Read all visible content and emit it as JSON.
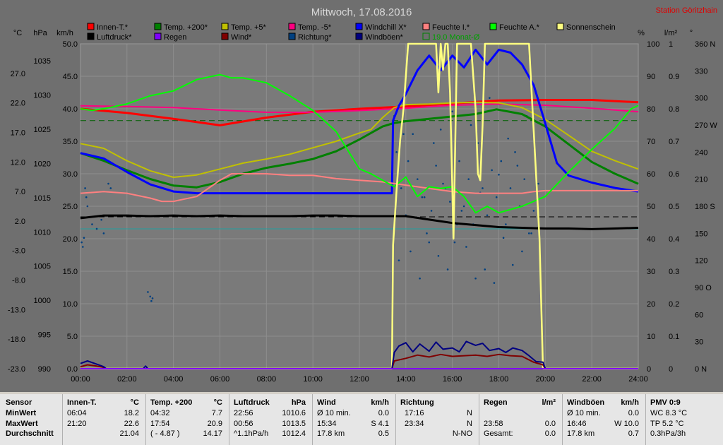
{
  "title": "Mittwoch, 17.08.2016",
  "station": "Station Göritzhain",
  "colors": {
    "plot_bg": "#7a7a7a",
    "grid": "#8e8e8e",
    "frame_bg": "#6f6f6f",
    "title": "#d8d8d8",
    "station": "#e00000"
  },
  "chart_data": {
    "type": "line",
    "x_ticks": [
      "00:00",
      "02:00",
      "04:00",
      "06:00",
      "08:00",
      "10:00",
      "12:00",
      "14:00",
      "16:00",
      "18:00",
      "20:00",
      "22:00",
      "24:00"
    ],
    "x_range_hours": [
      0,
      24
    ],
    "axes": {
      "celsius": {
        "unit": "°C",
        "range": [
          -23,
          32
        ],
        "ticks": [
          "27.0",
          "22.0",
          "17.0",
          "12.0",
          "7.0",
          "2.0",
          "-3.0",
          "-8.0",
          "-13.0",
          "-18.0",
          "-23.0"
        ]
      },
      "hpa": {
        "unit": "hPa",
        "range": [
          990,
          1037.5
        ],
        "ticks": [
          "1035",
          "1030",
          "1025",
          "1020",
          "1015",
          "1010",
          "1005",
          "1000",
          "995",
          "990"
        ]
      },
      "kmh": {
        "unit": "km/h",
        "range": [
          0,
          50
        ],
        "ticks": [
          "50.0",
          "45.0",
          "40.0",
          "35.0",
          "30.0",
          "25.0",
          "20.0",
          "15.0",
          "10.0",
          "5.0",
          "0.0"
        ]
      },
      "percent": {
        "unit": "%",
        "range": [
          0,
          100
        ],
        "ticks": [
          "100",
          "90",
          "80",
          "70",
          "60",
          "50",
          "40",
          "30",
          "20",
          "10",
          "0"
        ]
      },
      "lm2": {
        "unit": "l/m²",
        "range": [
          0,
          1
        ],
        "ticks": [
          "1",
          "0.9",
          "0.8",
          "0.7",
          "0.6",
          "0.5",
          "0.4",
          "0.3",
          "0.2",
          "0.1",
          "0"
        ]
      },
      "deg": {
        "unit": "°",
        "range": [
          0,
          360
        ],
        "ticks": [
          "360 N",
          "330",
          "300",
          "270 W",
          "240",
          "210",
          "180 S",
          "150",
          "120",
          "90 O",
          "60",
          "30",
          "0 N"
        ]
      }
    },
    "legend": [
      {
        "name": "Innen-T.*",
        "color": "#ff0000"
      },
      {
        "name": "Luftdruck*",
        "color": "#000000"
      },
      {
        "name": "Temp. +200*",
        "color": "#008000"
      },
      {
        "name": "Regen",
        "color": "#8000ff"
      },
      {
        "name": "Temp. +5*",
        "color": "#c0c000"
      },
      {
        "name": "Wind*",
        "color": "#800000"
      },
      {
        "name": "Temp. -5*",
        "color": "#ff0080"
      },
      {
        "name": "Richtung*",
        "color": "#004080"
      },
      {
        "name": "Windchill X*",
        "color": "#0000ff"
      },
      {
        "name": "Windböen*",
        "color": "#000080"
      },
      {
        "name": "Feuchte I.*",
        "color": "#ff8080"
      },
      {
        "name": "19.0 Monat-Ø",
        "color": "#008000",
        "text_color": "#00a000",
        "outlined": true
      },
      {
        "name": "Feuchte A.*",
        "color": "#00ff00"
      },
      {
        "name": "Sonnenschein",
        "color": "#ffff80"
      }
    ],
    "series": [
      {
        "name": "Innen-T.*",
        "axis": "celsius",
        "color": "#ff0000",
        "width": 3,
        "x": [
          0,
          2,
          4,
          6,
          8,
          10,
          12,
          14,
          16,
          18,
          20,
          22,
          24
        ],
        "y": [
          21.0,
          20.3,
          19.3,
          18.2,
          19.5,
          20.5,
          21.0,
          21.4,
          21.9,
          22.4,
          22.5,
          22.5,
          22.1
        ]
      },
      {
        "name": "Temp. -5*",
        "axis": "celsius",
        "color": "#ff0080",
        "width": 2,
        "x": [
          0,
          2,
          4,
          6,
          8,
          10,
          12,
          14,
          16,
          18,
          20,
          22,
          24
        ],
        "y": [
          21.5,
          21.4,
          21.2,
          20.8,
          20.4,
          20.4,
          20.7,
          21.1,
          21.6,
          21.8,
          21.6,
          21.1,
          20.5
        ]
      },
      {
        "name": "Temp. +200*",
        "axis": "celsius",
        "color": "#008000",
        "width": 3,
        "x": [
          0,
          1,
          2,
          3,
          4,
          5,
          6,
          7,
          8,
          9,
          10,
          11,
          12,
          13,
          13.5,
          14,
          15,
          16,
          17,
          17.9,
          19,
          20,
          21,
          22,
          23,
          24
        ],
        "y": [
          13.5,
          12.2,
          10.6,
          9.1,
          8.0,
          7.7,
          8.6,
          10.0,
          11.0,
          11.7,
          12.5,
          13.8,
          15.8,
          18.0,
          18.6,
          18.9,
          19.3,
          19.7,
          20.1,
          20.9,
          20.1,
          18.0,
          15.0,
          12.0,
          10.0,
          8.3
        ]
      },
      {
        "name": "Temp. +5*",
        "axis": "celsius",
        "color": "#c0c000",
        "width": 2,
        "x": [
          0,
          1,
          2,
          3,
          4,
          5,
          6,
          7,
          8,
          9,
          10,
          11,
          12,
          12.5,
          13,
          13.5,
          14,
          15,
          16,
          17,
          18,
          19,
          20,
          21,
          22,
          23,
          24
        ],
        "y": [
          15.1,
          14.3,
          12.2,
          10.5,
          9.4,
          9.8,
          10.8,
          11.8,
          12.5,
          13.3,
          14.4,
          15.5,
          16.9,
          17.5,
          19.5,
          21.2,
          21.7,
          21.8,
          22.0,
          22.1,
          22.0,
          21.2,
          19.2,
          16.5,
          13.8,
          12.2,
          10.8
        ]
      },
      {
        "name": "Windchill X*",
        "axis": "celsius",
        "color": "#0000ff",
        "width": 3,
        "x": [
          0,
          1,
          2,
          3,
          4,
          5,
          6,
          7,
          8,
          9,
          10,
          11,
          12,
          13.4,
          13.45,
          13.7,
          14,
          14.5,
          15,
          15.5,
          16,
          16.5,
          17,
          17.5,
          18,
          18.5,
          19,
          19.5,
          20,
          20.5,
          21,
          22,
          23,
          24
        ],
        "y": [
          13.5,
          12.6,
          10.3,
          8.2,
          7.0,
          6.7,
          6.7,
          6.7,
          6.7,
          6.7,
          6.7,
          6.7,
          6.7,
          6.7,
          19.0,
          21.5,
          23.5,
          27.5,
          30.0,
          27.5,
          30.0,
          28.0,
          31.0,
          28.5,
          31.0,
          30.5,
          28.5,
          25.0,
          18.5,
          11.8,
          9.7,
          8.5,
          7.6,
          7.0
        ]
      },
      {
        "name": "Feuchte I.*",
        "axis": "percent",
        "color": "#ff8080",
        "width": 2,
        "x": [
          0,
          1,
          2,
          3,
          3.5,
          4,
          5,
          6,
          6.5,
          7,
          8,
          9,
          10,
          11,
          12,
          13,
          14,
          15,
          16,
          17,
          18,
          19,
          19.5,
          20,
          21,
          22,
          23,
          24
        ],
        "y": [
          54,
          54.5,
          54,
          52.5,
          51.5,
          51.5,
          53,
          58,
          60,
          60,
          60,
          59.5,
          59.5,
          58.5,
          58,
          57.5,
          56.5,
          55.5,
          54.5,
          54,
          54,
          54,
          54.5,
          54.8,
          54.8,
          54.8,
          54.8,
          54.8
        ]
      },
      {
        "name": "Feuchte A.*",
        "axis": "percent",
        "color": "#00ff00",
        "width": 2,
        "x": [
          0,
          0.5,
          1,
          2,
          3,
          4,
          5,
          6,
          6.5,
          7,
          8,
          9,
          10,
          11,
          12,
          12.5,
          13,
          13.5,
          14,
          14.5,
          15,
          15.5,
          16,
          16.5,
          17,
          17.5,
          18,
          19,
          20,
          21,
          22,
          23,
          23.7,
          24
        ],
        "y": [
          80,
          79.5,
          80,
          81.5,
          84,
          85.5,
          89,
          90.5,
          89.5,
          89.5,
          88,
          84,
          79.5,
          73,
          61.5,
          60,
          58,
          56,
          59,
          53,
          56,
          55.5,
          56,
          53,
          48,
          50,
          48,
          50,
          53,
          60.5,
          67.5,
          74,
          80,
          81
        ]
      },
      {
        "name": "Luftdruck*",
        "axis": "hpa",
        "color": "#000000",
        "width": 3,
        "x": [
          0,
          1,
          2,
          3,
          4,
          5,
          6,
          7,
          8,
          9,
          10,
          11,
          12,
          13,
          14,
          15,
          16,
          17,
          18,
          19,
          20,
          21,
          22,
          23,
          24
        ],
        "y": [
          1012.0,
          1012.4,
          1012.4,
          1012.3,
          1012.4,
          1012.3,
          1012.4,
          1012.3,
          1012.3,
          1012.3,
          1012.4,
          1012.4,
          1012.3,
          1012.3,
          1012.3,
          1011.8,
          1011.3,
          1011.0,
          1010.7,
          1010.6,
          1010.5,
          1010.5,
          1010.4,
          1010.5,
          1010.6
        ]
      },
      {
        "name": "Sonnenschein",
        "axis": "percent",
        "color": "#ffff80",
        "width": 2.5,
        "x": [
          0,
          13.4,
          13.45,
          13.6,
          13.75,
          13.9,
          14.1,
          14.4,
          14.6,
          14.9,
          15.3,
          15.4,
          15.5,
          15.6,
          15.7,
          15.8,
          15.9,
          16.0,
          16.05,
          16.1,
          16.2,
          16.25,
          16.3,
          16.5,
          16.8,
          17.0,
          17.1,
          17.2,
          17.3,
          17.4,
          17.5,
          17.6,
          18.0,
          18.5,
          19.0,
          19.3,
          19.45,
          19.6,
          19.75,
          19.9,
          24
        ],
        "y": [
          0,
          0,
          38,
          55,
          70,
          80,
          100,
          100,
          100,
          100,
          100,
          85,
          100,
          92,
          100,
          100,
          85,
          55,
          40,
          60,
          100,
          100,
          100,
          100,
          100,
          80,
          60,
          58,
          75,
          100,
          100,
          100,
          100,
          100,
          100,
          100,
          80,
          60,
          40,
          0,
          0
        ]
      },
      {
        "name": "Wind*",
        "axis": "kmh",
        "color": "#800000",
        "width": 2,
        "x": [
          0,
          0.3,
          0.7,
          1.0,
          1.1,
          13.4,
          13.5,
          14,
          14.5,
          15,
          15.5,
          16,
          16.5,
          17,
          17.5,
          18,
          18.5,
          19,
          19.5,
          19.9,
          20.0,
          24
        ],
        "y": [
          0.3,
          0.6,
          0.4,
          0.2,
          0,
          0,
          1.2,
          1.6,
          2.1,
          1.8,
          2.2,
          1.9,
          2.0,
          2.1,
          1.9,
          2.2,
          2.0,
          1.9,
          1.0,
          0.6,
          0,
          0
        ]
      },
      {
        "name": "Windböen*",
        "axis": "kmh",
        "color": "#000080",
        "width": 2,
        "x": [
          0,
          0.3,
          0.7,
          1.0,
          1.1,
          2.7,
          2.8,
          2.9,
          13.4,
          13.5,
          13.7,
          14,
          14.3,
          14.6,
          15,
          15.3,
          15.6,
          16,
          16.3,
          16.6,
          17,
          17.3,
          17.6,
          18,
          18.3,
          18.6,
          19,
          19.3,
          19.6,
          19.9,
          20.0,
          24
        ],
        "y": [
          0.8,
          1.2,
          0.7,
          0.3,
          0,
          0,
          0.4,
          0,
          0,
          2.5,
          3.5,
          4.0,
          2.6,
          3.8,
          2.7,
          4.1,
          3.0,
          3.2,
          2.6,
          4.2,
          3.6,
          3.9,
          2.8,
          3.1,
          2.5,
          3.2,
          2.8,
          2.0,
          1.1,
          1.0,
          0,
          0
        ]
      },
      {
        "name": "Regen",
        "axis": "lm2",
        "color": "#8000ff",
        "width": 2,
        "x": [
          0,
          24
        ],
        "y": [
          0,
          0
        ]
      }
    ],
    "reference_lines": [
      {
        "name": "19.0 Monat-Ø",
        "axis": "celsius",
        "value": 19.0,
        "color": "#006000",
        "dash": true
      },
      {
        "name": "Luftdruck-Ref",
        "axis": "hpa",
        "value": 1012.2,
        "color": "#000000",
        "dash": true
      },
      {
        "name": "Richtung-Ref",
        "axis": "deg",
        "value": 155,
        "color": "#20a0a0",
        "dash": false
      }
    ],
    "scatter": {
      "name": "Richtung*",
      "axis": "deg",
      "color": "#004080",
      "x": [
        0.05,
        0.1,
        0.15,
        0.2,
        0.25,
        0.3,
        0.5,
        0.7,
        0.9,
        1.0,
        1.2,
        1.3,
        2.9,
        3.0,
        3.05,
        3.1,
        13.5,
        13.6,
        13.8,
        14.0,
        14.1,
        14.3,
        14.5,
        14.7,
        14.9,
        15.1,
        15.3,
        15.5,
        15.7,
        15.9,
        16.1,
        16.3,
        16.5,
        16.7,
        16.9,
        17.1,
        17.3,
        17.5,
        17.7,
        17.9,
        18.1,
        18.3,
        18.5,
        18.7,
        18.9,
        19.1,
        19.3,
        19.5,
        19.7,
        13.7,
        14.2,
        14.6,
        15.0,
        15.4,
        15.8,
        16.2,
        16.6,
        17.0,
        17.4,
        17.8,
        18.2,
        18.6,
        19.0,
        19.4,
        13.9,
        14.4,
        15.2,
        16.0,
        16.8,
        17.6,
        18.4,
        19.2,
        14.8,
        15.6,
        16.4,
        17.2,
        18.0,
        18.8
      ],
      "y": [
        140,
        135,
        145,
        200,
        190,
        180,
        160,
        155,
        165,
        150,
        205,
        200,
        85,
        80,
        75,
        78,
        280,
        240,
        200,
        170,
        230,
        260,
        210,
        190,
        150,
        175,
        225,
        265,
        200,
        185,
        140,
        230,
        180,
        210,
        160,
        250,
        200,
        170,
        220,
        190,
        230,
        160,
        200,
        240,
        180,
        210,
        150,
        175,
        205,
        120,
        130,
        100,
        140,
        125,
        110,
        160,
        135,
        100,
        110,
        95,
        145,
        115,
        130,
        150,
        260,
        290,
        250,
        285,
        270,
        300,
        255,
        280,
        190,
        205,
        175,
        195,
        215,
        225
      ]
    }
  },
  "stats": {
    "sensor": {
      "header": "Sensor",
      "rows": [
        "MinWert",
        "MaxWert",
        "Durchschnitt"
      ]
    },
    "innen": {
      "header": "Innen-T.",
      "unit": "°C",
      "rows": [
        [
          "06:04",
          "18.2"
        ],
        [
          "21:20",
          "22.6"
        ],
        [
          "",
          "21.04"
        ]
      ]
    },
    "temp200": {
      "header": "Temp. +200",
      "unit": "°C",
      "rows": [
        [
          "04:32",
          "7.7"
        ],
        [
          "17:54",
          "20.9"
        ],
        [
          "( - 4.87 )",
          "14.17"
        ]
      ]
    },
    "luftdruck": {
      "header": "Luftdruck",
      "unit": "hPa",
      "rows": [
        [
          "22:56",
          "1010.6"
        ],
        [
          "00:56",
          "1013.5"
        ],
        [
          "^1.1hPa/h",
          "1012.4"
        ]
      ]
    },
    "wind": {
      "header": "Wind",
      "unit": "km/h",
      "rows": [
        [
          "Ø 10 min.",
          "0.0"
        ],
        [
          "15:34",
          "S 4.1"
        ],
        [
          "17.8 km",
          "0.5"
        ]
      ]
    },
    "richtung": {
      "header": "Richtung",
      "unit": "",
      "rows": [
        [
          "17:16",
          "N"
        ],
        [
          "23:34",
          "N"
        ],
        [
          "",
          "N-NO"
        ]
      ]
    },
    "regen": {
      "header": "Regen",
      "unit": "l/m²",
      "rows": [
        [
          "",
          ""
        ],
        [
          "23:58",
          "0.0"
        ],
        [
          "Gesamt:",
          "0.0"
        ]
      ]
    },
    "windboeen": {
      "header": "Windböen",
      "unit": "km/h",
      "rows": [
        [
          "Ø 10 min.",
          "0.0"
        ],
        [
          "16:46",
          "W 10.0"
        ],
        [
          "17.8 km",
          "0.7"
        ]
      ]
    },
    "pmv": {
      "header": "PMV 0:9",
      "rows": [
        "WC 8.3 °C",
        "TP 5.2 °C",
        "0.3hPa/3h"
      ]
    }
  }
}
